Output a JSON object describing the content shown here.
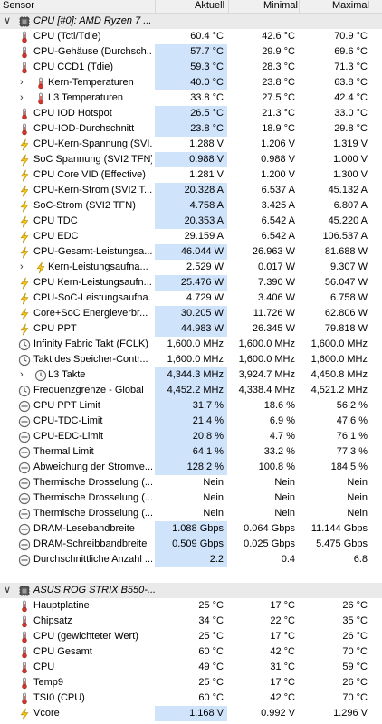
{
  "header": {
    "sensor": "Sensor",
    "current": "Aktuell",
    "minimum": "Minimal",
    "maximum": "Maximal"
  },
  "groups": [
    {
      "title": "CPU [#0]: AMD Ryzen 7 ...",
      "rows": [
        {
          "icon": "thermometer-icon",
          "name": "CPU (Tctl/Tdie)",
          "cur": "60.4 °C",
          "min": "42.6 °C",
          "max": "70.9 °C",
          "hl": false
        },
        {
          "icon": "thermometer-icon",
          "name": "CPU-Gehäuse (Durchsch...",
          "cur": "57.7 °C",
          "min": "29.9 °C",
          "max": "69.6 °C",
          "hl": true
        },
        {
          "icon": "thermometer-icon",
          "name": "CPU CCD1 (Tdie)",
          "cur": "59.3 °C",
          "min": "28.3 °C",
          "max": "71.3 °C",
          "hl": true
        },
        {
          "icon": "thermometer-icon",
          "name": "Kern-Temperaturen",
          "cur": "40.0 °C",
          "min": "23.8 °C",
          "max": "63.8 °C",
          "hl": true,
          "expand": true
        },
        {
          "icon": "thermometer-icon",
          "name": "L3 Temperaturen",
          "cur": "33.8 °C",
          "min": "27.5 °C",
          "max": "42.4 °C",
          "hl": false,
          "expand": true
        },
        {
          "icon": "thermometer-icon",
          "name": "CPU IOD Hotspot",
          "cur": "26.5 °C",
          "min": "21.3 °C",
          "max": "33.0 °C",
          "hl": true
        },
        {
          "icon": "thermometer-icon",
          "name": "CPU-IOD-Durchschnitt",
          "cur": "23.8 °C",
          "min": "18.9 °C",
          "max": "29.8 °C",
          "hl": true
        },
        {
          "icon": "bolt-icon",
          "name": "CPU-Kern-Spannung (SVI...",
          "cur": "1.288 V",
          "min": "1.206 V",
          "max": "1.319 V",
          "hl": false
        },
        {
          "icon": "bolt-icon",
          "name": "SoC Spannung (SVI2 TFN)",
          "cur": "0.988 V",
          "min": "0.988 V",
          "max": "1.000 V",
          "hl": true
        },
        {
          "icon": "bolt-icon",
          "name": "CPU Core VID (Effective)",
          "cur": "1.281 V",
          "min": "1.200 V",
          "max": "1.300 V",
          "hl": false
        },
        {
          "icon": "bolt-icon",
          "name": "CPU-Kern-Strom (SVI2 T...",
          "cur": "20.328 A",
          "min": "6.537 A",
          "max": "45.132 A",
          "hl": true
        },
        {
          "icon": "bolt-icon",
          "name": "SoC-Strom (SVI2 TFN)",
          "cur": "4.758 A",
          "min": "3.425 A",
          "max": "6.807 A",
          "hl": true
        },
        {
          "icon": "bolt-icon",
          "name": "CPU TDC",
          "cur": "20.353 A",
          "min": "6.542 A",
          "max": "45.220 A",
          "hl": true
        },
        {
          "icon": "bolt-icon",
          "name": "CPU EDC",
          "cur": "29.159 A",
          "min": "6.542 A",
          "max": "106.537 A",
          "hl": false
        },
        {
          "icon": "bolt-icon",
          "name": "CPU-Gesamt-Leistungsa...",
          "cur": "46.044 W",
          "min": "26.963 W",
          "max": "81.688 W",
          "hl": true
        },
        {
          "icon": "bolt-icon",
          "name": "Kern-Leistungsaufna...",
          "cur": "2.529 W",
          "min": "0.017 W",
          "max": "9.307 W",
          "hl": false,
          "expand": true
        },
        {
          "icon": "bolt-icon",
          "name": "CPU Kern-Leistungsaufn...",
          "cur": "25.476 W",
          "min": "7.390 W",
          "max": "56.047 W",
          "hl": true
        },
        {
          "icon": "bolt-icon",
          "name": "CPU-SoC-Leistungsaufna...",
          "cur": "4.729 W",
          "min": "3.406 W",
          "max": "6.758 W",
          "hl": false
        },
        {
          "icon": "bolt-icon",
          "name": "Core+SoC Energieverbr...",
          "cur": "30.205 W",
          "min": "11.726 W",
          "max": "62.806 W",
          "hl": true
        },
        {
          "icon": "bolt-icon",
          "name": "CPU PPT",
          "cur": "44.983 W",
          "min": "26.345 W",
          "max": "79.818 W",
          "hl": true
        },
        {
          "icon": "clock-icon",
          "name": "Infinity Fabric Takt (FCLK)",
          "cur": "1,600.0 MHz",
          "min": "1,600.0 MHz",
          "max": "1,600.0 MHz",
          "hl": false
        },
        {
          "icon": "clock-icon",
          "name": "Takt des Speicher-Contr...",
          "cur": "1,600.0 MHz",
          "min": "1,600.0 MHz",
          "max": "1,600.0 MHz",
          "hl": false
        },
        {
          "icon": "clock-icon",
          "name": "L3 Takte",
          "cur": "4,344.3 MHz",
          "min": "3,924.7 MHz",
          "max": "4,450.8 MHz",
          "hl": true,
          "expand": true
        },
        {
          "icon": "clock-icon",
          "name": "Frequenzgrenze - Global",
          "cur": "4,452.2 MHz",
          "min": "4,338.4 MHz",
          "max": "4,521.2 MHz",
          "hl": true
        },
        {
          "icon": "gauge-icon",
          "name": "CPU PPT Limit",
          "cur": "31.7 %",
          "min": "18.6 %",
          "max": "56.2 %",
          "hl": true
        },
        {
          "icon": "gauge-icon",
          "name": "CPU-TDC-Limit",
          "cur": "21.4 %",
          "min": "6.9 %",
          "max": "47.6 %",
          "hl": true
        },
        {
          "icon": "gauge-icon",
          "name": "CPU-EDC-Limit",
          "cur": "20.8 %",
          "min": "4.7 %",
          "max": "76.1 %",
          "hl": true
        },
        {
          "icon": "gauge-icon",
          "name": "Thermal Limit",
          "cur": "64.1 %",
          "min": "33.2 %",
          "max": "77.3 %",
          "hl": true
        },
        {
          "icon": "gauge-icon",
          "name": "Abweichung der Stromve...",
          "cur": "128.2 %",
          "min": "100.8 %",
          "max": "184.5 %",
          "hl": true
        },
        {
          "icon": "gauge-icon",
          "name": "Thermische Drosselung (...",
          "cur": "Nein",
          "min": "Nein",
          "max": "Nein",
          "hl": false
        },
        {
          "icon": "gauge-icon",
          "name": "Thermische Drosselung (...",
          "cur": "Nein",
          "min": "Nein",
          "max": "Nein",
          "hl": false
        },
        {
          "icon": "gauge-icon",
          "name": "Thermische Drosselung (...",
          "cur": "Nein",
          "min": "Nein",
          "max": "Nein",
          "hl": false
        },
        {
          "icon": "gauge-icon",
          "name": "DRAM-Lesebandbreite",
          "cur": "1.088 Gbps",
          "min": "0.064 Gbps",
          "max": "11.144 Gbps",
          "hl": true
        },
        {
          "icon": "gauge-icon",
          "name": "DRAM-Schreibbandbreite",
          "cur": "0.509 Gbps",
          "min": "0.025 Gbps",
          "max": "5.475 Gbps",
          "hl": true
        },
        {
          "icon": "gauge-icon",
          "name": "Durchschnittliche Anzahl ...",
          "cur": "2.2",
          "min": "0.4",
          "max": "6.8",
          "hl": true
        }
      ]
    },
    {
      "title": "ASUS ROG STRIX B550-...",
      "rows": [
        {
          "icon": "thermometer-icon",
          "name": "Hauptplatine",
          "cur": "25 °C",
          "min": "17 °C",
          "max": "26 °C",
          "hl": false
        },
        {
          "icon": "thermometer-icon",
          "name": "Chipsatz",
          "cur": "34 °C",
          "min": "22 °C",
          "max": "35 °C",
          "hl": false
        },
        {
          "icon": "thermometer-icon",
          "name": "CPU (gewichteter Wert)",
          "cur": "25 °C",
          "min": "17 °C",
          "max": "26 °C",
          "hl": false
        },
        {
          "icon": "thermometer-icon",
          "name": "CPU Gesamt",
          "cur": "60 °C",
          "min": "42 °C",
          "max": "70 °C",
          "hl": false
        },
        {
          "icon": "thermometer-icon",
          "name": "CPU",
          "cur": "49 °C",
          "min": "31 °C",
          "max": "59 °C",
          "hl": false
        },
        {
          "icon": "thermometer-icon",
          "name": "Temp9",
          "cur": "25 °C",
          "min": "17 °C",
          "max": "26 °C",
          "hl": false
        },
        {
          "icon": "thermometer-icon",
          "name": "TSI0 (CPU)",
          "cur": "60 °C",
          "min": "42 °C",
          "max": "70 °C",
          "hl": false
        },
        {
          "icon": "bolt-icon",
          "name": "Vcore",
          "cur": "1.168 V",
          "min": "0.992 V",
          "max": "1.296 V",
          "hl": true
        }
      ]
    }
  ]
}
